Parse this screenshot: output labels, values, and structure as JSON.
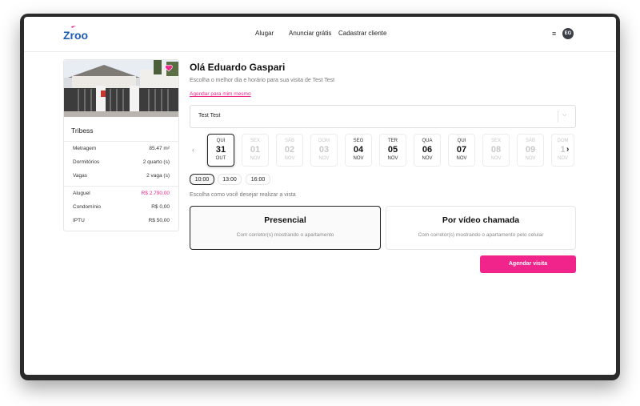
{
  "header": {
    "logo_text": "Zroo",
    "nav": [
      "Alugar",
      "Anunciar grátis",
      "Cadastrar cliente"
    ],
    "menu_icon": "menu-icon",
    "avatar_initials": "EG"
  },
  "property": {
    "name": "Tribess",
    "details": [
      {
        "label": "Metragem",
        "value": "85.47 m²"
      },
      {
        "label": "Dormitórios",
        "value": "2 quarto (s)"
      },
      {
        "label": "Vagas",
        "value": "2 vaga (s)"
      }
    ],
    "costs": [
      {
        "label": "Aluguel",
        "value": "R$ 2.790,00"
      },
      {
        "label": "Condomínio",
        "value": "R$ 0,00"
      },
      {
        "label": "IPTU",
        "value": "R$ 50,00"
      }
    ],
    "favorite_icon": "heart-icon"
  },
  "main": {
    "greeting": "Olá Eduardo Gaspari",
    "subtitle": "Escolha o melhor dia e horário para sua visita de Test Test",
    "schedule_self_link": "Agendar para mim mesmo",
    "selected_person": "Test Test",
    "dates": [
      {
        "dow": "QUI",
        "day": "31",
        "month": "OUT",
        "state": "selected"
      },
      {
        "dow": "SEX",
        "day": "01",
        "month": "NOV",
        "state": "disabled"
      },
      {
        "dow": "SÁB",
        "day": "02",
        "month": "NOV",
        "state": "disabled"
      },
      {
        "dow": "DOM",
        "day": "03",
        "month": "NOV",
        "state": "disabled"
      },
      {
        "dow": "SEG",
        "day": "04",
        "month": "NOV",
        "state": "enabled"
      },
      {
        "dow": "TER",
        "day": "05",
        "month": "NOV",
        "state": "enabled"
      },
      {
        "dow": "QUA",
        "day": "06",
        "month": "NOV",
        "state": "enabled"
      },
      {
        "dow": "QUI",
        "day": "07",
        "month": "NOV",
        "state": "enabled"
      },
      {
        "dow": "SEX",
        "day": "08",
        "month": "NOV",
        "state": "disabled"
      },
      {
        "dow": "SÁB",
        "day": "09",
        "month": "NOV",
        "state": "disabled"
      },
      {
        "dow": "DOM",
        "day": "1",
        "month": "NOV",
        "state": "disabled"
      }
    ],
    "times": [
      "10:00",
      "13:00",
      "16:00"
    ],
    "selected_time": "10:00",
    "visit_prompt": "Escolha como você desejar realizar a vista",
    "visit_options": [
      {
        "title": "Presencial",
        "desc": "Com corretor(s) mostrando o apartamento",
        "selected": true
      },
      {
        "title": "Por vídeo chamada",
        "desc": "Com corretor(s) mostrando o apartamento pelo celular",
        "selected": false
      }
    ],
    "cta_label": "Agendar visita"
  },
  "colors": {
    "accent": "#f1248c",
    "logo_blue": "#1c5bb8",
    "text": "#111111",
    "muted": "#777777"
  }
}
